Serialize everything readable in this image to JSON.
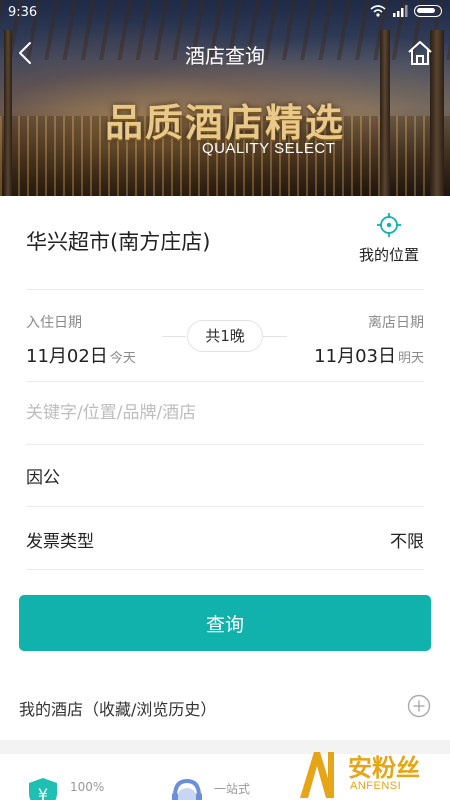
{
  "status_bar": {
    "time": "9:36"
  },
  "nav": {
    "title": "酒店查询",
    "back_icon": "back-arrow-icon",
    "home_icon": "home-icon"
  },
  "banner": {
    "headline": "品质酒店精选",
    "subtitle": "QUALITY SELECT"
  },
  "destination": {
    "text": "华兴超市(南方庄店)",
    "location_label": "我的位置",
    "location_icon": "crosshair-icon",
    "accent": "#12b2ac"
  },
  "dates": {
    "checkin_label": "入住日期",
    "checkout_label": "离店日期",
    "checkin_date": "11月02日",
    "checkin_sub": "今天",
    "checkout_date": "11月03日",
    "checkout_sub": "明天",
    "nights": "共1晚"
  },
  "search": {
    "placeholder": "关键字/位置/品牌/酒店",
    "value": ""
  },
  "purpose": {
    "text": "因公"
  },
  "invoice": {
    "label": "发票类型",
    "value": "不限"
  },
  "search_button": {
    "label": "查询",
    "color": "#12b2ac"
  },
  "my_hotel": {
    "label": "我的酒店（收藏/浏览历史）",
    "icon": "plus-circle-icon"
  },
  "features": [
    {
      "text": "100%",
      "icon": "yen-shield-icon"
    },
    {
      "text": "一站式",
      "icon": "headset-icon"
    },
    {
      "text": "",
      "icon": ""
    }
  ],
  "watermark": {
    "text": "安粉丝",
    "sub": "ANFENSI"
  }
}
